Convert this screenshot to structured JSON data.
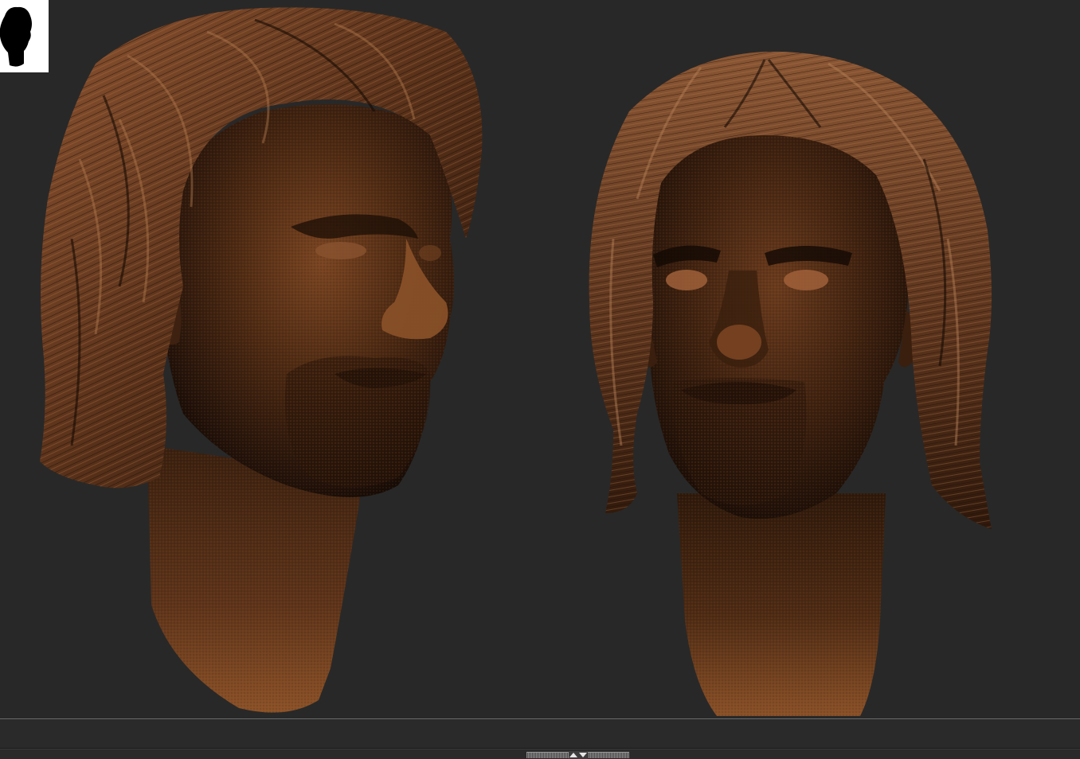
{
  "viewport": {
    "background_color": "#282828",
    "material_color": "#8a4f26",
    "model_views": [
      "three-quarter-view",
      "front-view"
    ]
  },
  "navigator": {
    "icon": "head-silhouette-icon",
    "background_color": "#ffffff"
  },
  "tray": {
    "handle_icon": "tray-toggle-arrows-icon"
  }
}
